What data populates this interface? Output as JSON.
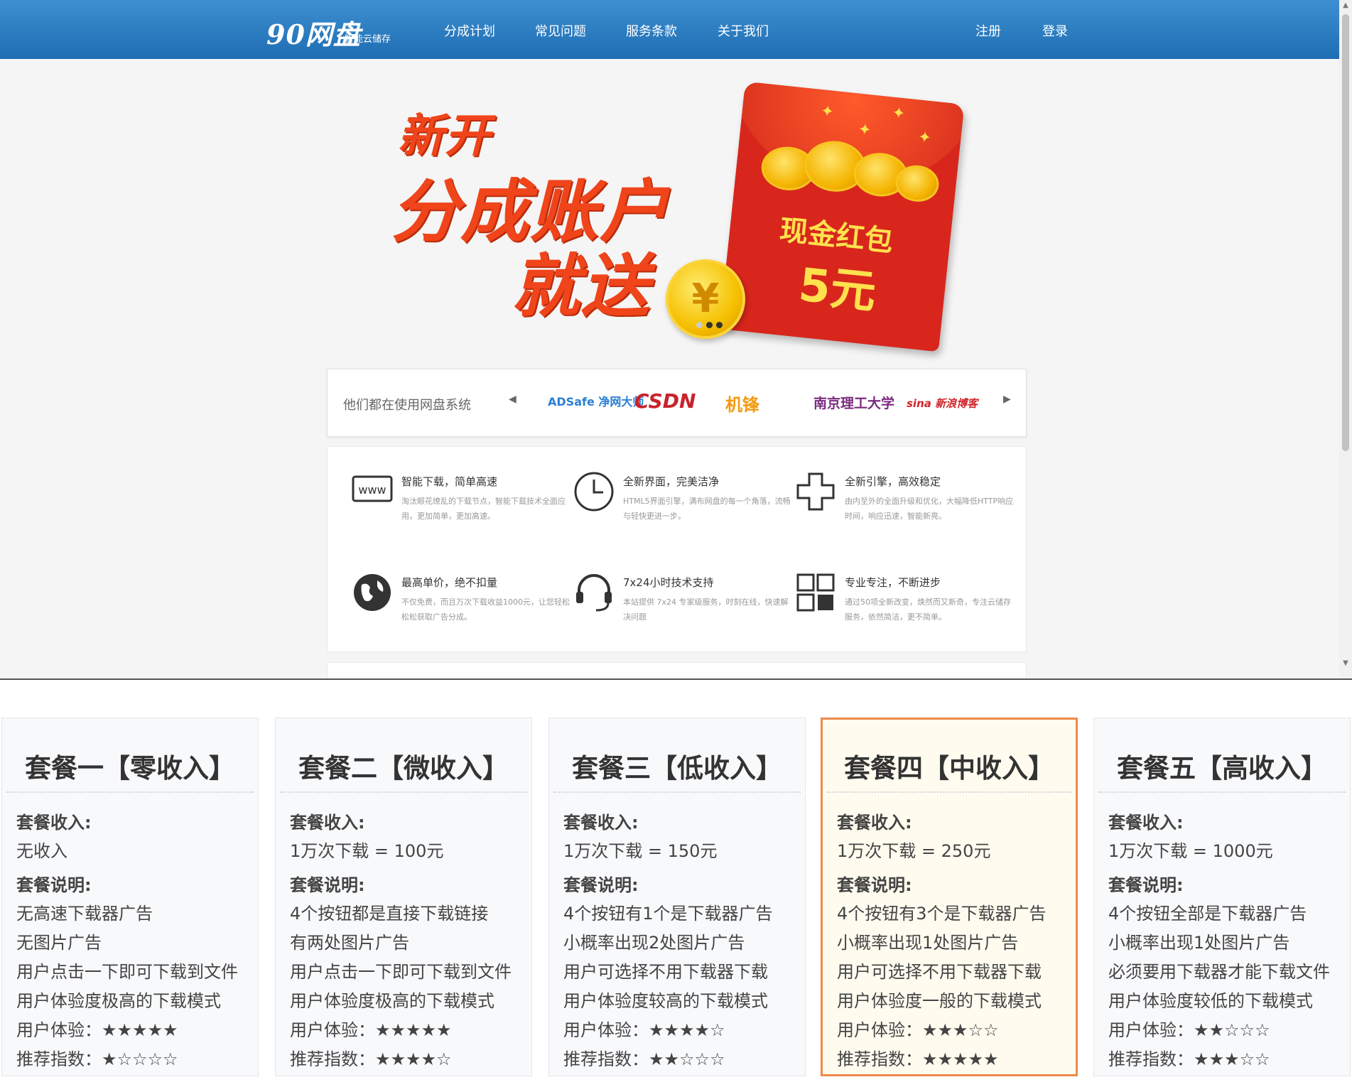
{
  "navbar": {
    "logo": "90网盘",
    "logo_sub": "智能云储存",
    "links": [
      "分成计划",
      "常见问题",
      "服务条款",
      "关于我们"
    ],
    "register": "注册",
    "login": "登录"
  },
  "banner": {
    "line1": "新开",
    "line2": "分成账户",
    "line3": "就送",
    "envelope_text": "现金红包",
    "envelope_amount": "5元",
    "coin_symbol": "¥"
  },
  "partners": {
    "title": "他们都在使用网盘系统",
    "prev_arrow": "◀",
    "next_arrow": "▶",
    "logos": [
      {
        "name": "ADSafe 净网大师",
        "color": "#2a7fd4"
      },
      {
        "name": "CSDN",
        "color": "#c8232c"
      },
      {
        "name": "机锋",
        "color": "#f29a12"
      },
      {
        "name": "南京理工大学",
        "color": "#7a2a7f"
      },
      {
        "name": "sina 新浪博客",
        "color": "#d0262b"
      }
    ]
  },
  "features": [
    {
      "title": "智能下载，简单高速",
      "desc": "淘汰眼花缭乱的下载节点，智能下载技术全面应用，更加简单，更加高速。",
      "icon": "www-icon"
    },
    {
      "title": "全新界面，完美洁净",
      "desc": "HTML5界面引擎，满布网盘的每一个角落，流畅与轻快更进一步。",
      "icon": "clock-icon"
    },
    {
      "title": "全新引擎，高效稳定",
      "desc": "由内至外的全面升级和优化，大幅降低HTTP响应时间，响应迅速，智能新亮。",
      "icon": "puzzle-icon"
    },
    {
      "title": "最高单价，绝不扣量",
      "desc": "不仅免费，而且万次下载收益1000元，让您轻松松松获取广告分成。",
      "icon": "globe-icon"
    },
    {
      "title": "7x24小时技术支持",
      "desc": "本站提供 7x24 专家级服务，时刻在线，快速解决问题",
      "icon": "headset-icon"
    },
    {
      "title": "专业专注，不断进步",
      "desc": "通过50项全新改变，焕然而又新奇，专注云储存服务，依然简洁，更不简单。",
      "icon": "grid-icon"
    }
  ],
  "plans": [
    {
      "title": "套餐一【零收入】",
      "income_label": "套餐收入:",
      "income": "无收入",
      "desc_label": "套餐说明:",
      "desc": [
        "无高速下载器广告",
        "无图片广告",
        "用户点击一下即可下载到文件",
        "用户体验度极高的下载模式"
      ],
      "experience": "用户体验：★★★★★",
      "recommend": "推荐指数：★☆☆☆☆",
      "featured": false
    },
    {
      "title": "套餐二【微收入】",
      "income_label": "套餐收入:",
      "income": "1万次下载 = 100元",
      "desc_label": "套餐说明:",
      "desc": [
        "4个按钮都是直接下载链接",
        "有两处图片广告",
        "用户点击一下即可下载到文件",
        "用户体验度极高的下载模式"
      ],
      "experience": "用户体验：★★★★★",
      "recommend": "推荐指数：★★★★☆",
      "featured": false
    },
    {
      "title": "套餐三【低收入】",
      "income_label": "套餐收入:",
      "income": "1万次下载 = 150元",
      "desc_label": "套餐说明:",
      "desc": [
        "4个按钮有1个是下载器广告",
        "小概率出现2处图片广告",
        "用户可选择不用下载器下载",
        "用户体验度较高的下载模式"
      ],
      "experience": "用户体验：★★★★☆",
      "recommend": "推荐指数：★★☆☆☆",
      "featured": false
    },
    {
      "title": "套餐四【中收入】",
      "income_label": "套餐收入:",
      "income": "1万次下载 = 250元",
      "desc_label": "套餐说明:",
      "desc": [
        "4个按钮有3个是下载器广告",
        "小概率出现1处图片广告",
        "用户可选择不用下载器下载",
        "用户体验度一般的下载模式"
      ],
      "experience": "用户体验：★★★☆☆",
      "recommend": "推荐指数：★★★★★",
      "featured": true
    },
    {
      "title": "套餐五【高收入】",
      "income_label": "套餐收入:",
      "income": "1万次下载 = 1000元",
      "desc_label": "套餐说明:",
      "desc": [
        "4个按钮全部是下载器广告",
        "小概率出现1处图片广告",
        "必须要用下载器才能下载文件",
        "用户体验度较低的下载模式"
      ],
      "experience": "用户体验：★★☆☆☆",
      "recommend": "推荐指数：★★★☆☆",
      "featured": false
    }
  ]
}
